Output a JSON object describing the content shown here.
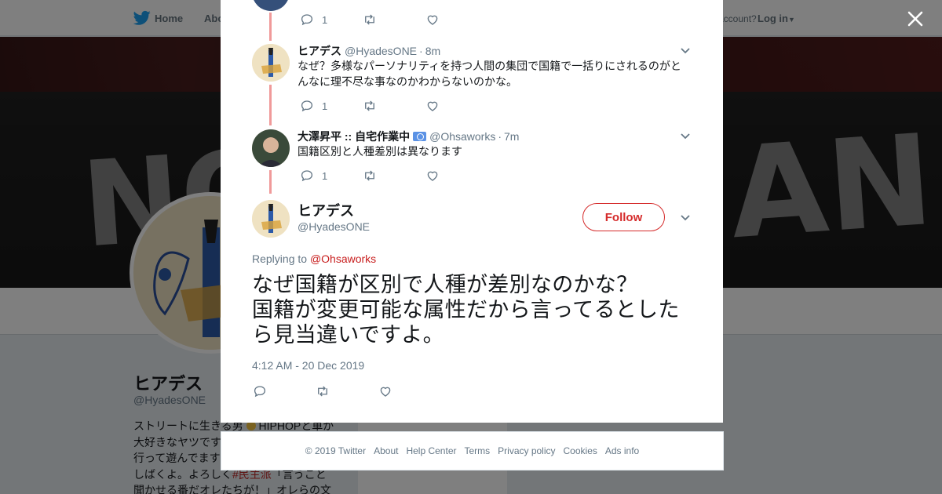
{
  "topbar": {
    "home_label": "Home",
    "about_label": "Abo",
    "have_account": "account?",
    "login_label": "Log in"
  },
  "banner": {
    "graffiti_left": "NO",
    "graffiti_right": "AN!"
  },
  "background_profile": {
    "name": "ヒアデス",
    "handle": "@HyadesONE",
    "bio_line1": "ストリートに生きる男",
    "bio_line1b": "HIPHOPと車が",
    "bio_line2": "大好きなヤツです",
    "bio_line3": "行って遊んでます",
    "bio_line4a": "しばくよ。よろしく",
    "bio_line4_tag": "#民主派",
    "bio_line4b": "「言うこと",
    "bio_line5": "聞かせる番だオレたちが！」オレらの文",
    "panel_text": "Ads info"
  },
  "thread": [
    {
      "name": "",
      "handle": "",
      "time": "",
      "text": "",
      "reply_count": "1"
    },
    {
      "name": "ヒアデス",
      "handle": "@HyadesONE",
      "time": "8m",
      "text": "なぜ？多様なパーソナリティを持つ人間の集団で国籍で一括りにされるのがとんなに理不尽な事なのかわからないのかな。",
      "reply_count": "1"
    },
    {
      "name": "大澤昇平 :: 自宅作業中",
      "handle": "@Ohsaworks",
      "time": "7m",
      "text": "国籍区別と人種差別は異なります",
      "reply_count": "1"
    }
  ],
  "main_tweet": {
    "name": "ヒアデス",
    "handle": "@HyadesONE",
    "follow_label": "Follow",
    "replying_prefix": "Replying to",
    "replying_to": "@Ohsaworks",
    "text": "なぜ国籍が区別で人種が差別なのかな？\n国籍が変更可能な属性だから言ってるとしたら見当違いですよ。",
    "timestamp": "4:12 AM - 20 Dec 2019"
  },
  "footer": {
    "links": [
      "© 2019 Twitter",
      "About",
      "Help Center",
      "Terms",
      "Privacy policy",
      "Cookies",
      "Ads info"
    ]
  },
  "colors": {
    "accent_red": "#d52b2b",
    "thread_line": "#f09a9a",
    "muted": "#657786"
  }
}
